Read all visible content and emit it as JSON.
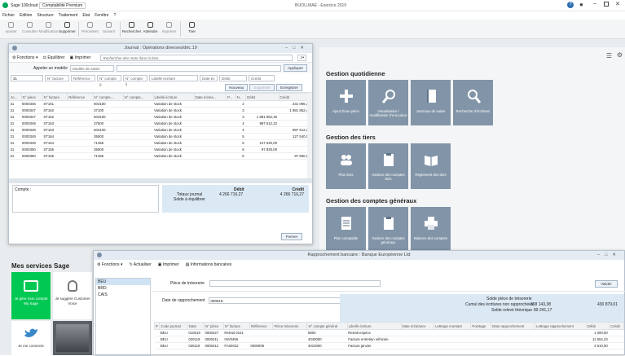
{
  "app": {
    "product": "Sage 100cloud",
    "module": "Comptabilité Premium",
    "title": "BIJOU.MAE - Exercice 2019"
  },
  "menu": [
    "Fichier",
    "Edition",
    "Structure",
    "Traitement",
    "Etat",
    "Fenêtre",
    "?"
  ],
  "toolbar": [
    {
      "label": "Ajouter",
      "on": false
    },
    {
      "label": "Consulter",
      "on": false
    },
    {
      "label": "Modification",
      "on": false
    },
    {
      "label": "Supprimer",
      "on": true
    },
    {
      "label": "Précédent",
      "on": false
    },
    {
      "label": "Suivant",
      "on": false
    },
    {
      "label": "Rechercher",
      "on": true
    },
    {
      "label": "Atteindre",
      "on": true
    },
    {
      "label": "Imprimer",
      "on": false
    },
    {
      "label": "Trier",
      "on": true
    }
  ],
  "journal": {
    "title": "Journal : Opérations diverses/déc.19",
    "functions": "Fonctions",
    "balance": "Équilibrer",
    "print": "Imprimer",
    "search_placeholder": "Rechercher des mots dans la liste...",
    "model_label": "Appeler un modèle",
    "model_value": "Modèle de saisie",
    "apply": "Appliquer",
    "entry_day": "31",
    "entry_fields": [
      "N° facture",
      "Référence",
      "N° compte g",
      "N° compte ti",
      "Libellé écriture",
      "Date éc",
      "Débit",
      "Crédit"
    ],
    "new": "Nouveau",
    "delete": "Supprimer",
    "save": "Enregistrer",
    "columns": [
      "Jo...",
      "N° pièce",
      "N° facture",
      "Référence",
      "N° compte...",
      "N° compte...",
      "Libellé écriture",
      "Date échéa...",
      "P...",
      "N...",
      "Débit",
      "Crédit"
    ],
    "rows": [
      [
        "31",
        "0000346",
        "ST161",
        "",
        "603100",
        "",
        "Variation de stock",
        "",
        "",
        "2",
        "",
        "231 096,32"
      ],
      [
        "31",
        "0000347",
        "ST162",
        "",
        "37100",
        "",
        "Variation de stock",
        "",
        "",
        "3",
        "",
        "1 881 852,46"
      ],
      [
        "31",
        "0000347",
        "ST162",
        "",
        "603100",
        "",
        "Variation de stock",
        "",
        "",
        "3",
        "1 881 852,46",
        ""
      ],
      [
        "31",
        "0000348",
        "ST163",
        "",
        "37500",
        "",
        "Variation de stock",
        "",
        "",
        "4",
        "987 512,22",
        ""
      ],
      [
        "31",
        "0000348",
        "ST163",
        "",
        "603100",
        "",
        "Variation de stock",
        "",
        "",
        "4",
        "",
        "987 512,22"
      ],
      [
        "31",
        "0000349",
        "ST164",
        "",
        "35500",
        "",
        "Variation de stock",
        "",
        "",
        "5",
        "",
        "127 540,00"
      ],
      [
        "31",
        "0000349",
        "ST164",
        "",
        "71355",
        "",
        "Variation de stock",
        "",
        "",
        "5",
        "127 540,00",
        ""
      ],
      [
        "31",
        "0000350",
        "ST165",
        "",
        "35500",
        "",
        "Variation de stock",
        "",
        "",
        "6",
        "97 830,00",
        ""
      ],
      [
        "31",
        "0000350",
        "ST165",
        "",
        "71355",
        "",
        "Variation de stock",
        "",
        "",
        "6",
        "",
        "97 830,00"
      ]
    ],
    "compte_label": "Compte :",
    "debit_h": "Débit",
    "credit_h": "Crédit",
    "total_label": "Totaux journal",
    "total_debit": "4 266 716,27",
    "total_credit": "4 266 716,27",
    "solde_label": "Solde à équilibrer",
    "close": "Fermer"
  },
  "services": {
    "title": "Mes services Sage",
    "tiles": [
      {
        "label": "Je gère mon compte My Sage",
        "icon": "id-card-icon"
      },
      {
        "label": "Je suggère Customer Voice",
        "icon": "lightbulb-icon"
      },
      {
        "label": "",
        "icon": "people-icon"
      },
      {
        "label": "Je me connecte",
        "icon": "twitter-icon"
      }
    ]
  },
  "groups": [
    {
      "title": "Gestion quotidienne",
      "tiles": [
        {
          "label": "Ajout d'une pièce",
          "icon": "plus-icon"
        },
        {
          "label": "Visualisation / modification d'une pièce",
          "icon": "magnifier-icon"
        },
        {
          "label": "Journaux de saisie",
          "icon": "book-icon"
        },
        {
          "label": "Recherche d'écritures",
          "icon": "search-doc-icon"
        }
      ]
    },
    {
      "title": "Gestion des tiers",
      "tiles": [
        {
          "label": "Plan tiers",
          "icon": "people-icon"
        },
        {
          "label": "Gestion des comptes tiers",
          "icon": "clipboard-icon"
        },
        {
          "label": "Réglement des tiers",
          "icon": "open-book-icon"
        }
      ]
    },
    {
      "title": "Gestion des comptes généraux",
      "tiles": [
        {
          "label": "Plan comptable",
          "icon": "list-doc-icon"
        },
        {
          "label": "Gestion des comptes généraux",
          "icon": "clipboard-icon"
        },
        {
          "label": "Balance des comptes",
          "icon": "printer-icon"
        }
      ]
    }
  ],
  "rappro": {
    "title": "Rapprochement bancaire : Banque Européenne Ltd",
    "functions": "Fonctions",
    "refresh": "Actualiser",
    "print": "Imprimer",
    "bank_info": "Informations bancaires",
    "journals": [
      "BEU",
      "BRD",
      "CAIS"
    ],
    "piece_label": "Pièce de trésorerie",
    "validate": "Valider",
    "date_label": "Date de rapprochement",
    "date_value": "080819",
    "solde_piece": "Solde pièce de trésorerie",
    "cumul_label": "Cumul des écritures non rapprochées",
    "cumul_val1": "368 143,38",
    "cumul_val2": "430 879,01",
    "solde_releve": "Solde relevé théorique",
    "releve_val": "89 241,17",
    "columns": [
      "P",
      "Code journal",
      "Date",
      "N° pièce",
      "N° facture",
      "Référence",
      "Pièce trésorerie",
      "N° compte général",
      "Libellé écriture",
      "Date échéance",
      "Lettrage montant",
      "Pointage",
      "Date rapprochement",
      "Lettrage rapprochement",
      "Débit",
      "Crédit"
    ],
    "rows": [
      [
        "",
        "BEU",
        "010519",
        "0000427",
        "Retrait 0101",
        "",
        "",
        "5800",
        "Retrait espèce",
        "",
        "",
        "",
        "",
        "",
        "1 000,00",
        ""
      ],
      [
        "",
        "BEU",
        "020119",
        "0000411",
        "INV0456",
        "",
        "",
        "4040000",
        "Facture entretien véhicule",
        "",
        "",
        "",
        "",
        "",
        "11 554,23",
        ""
      ],
      [
        "",
        "BEU",
        "030119",
        "0000412",
        "FA00022",
        "0000005",
        "",
        "4010000",
        "Facture janvier",
        "",
        "",
        "",
        "",
        "",
        "4 610,00",
        ""
      ]
    ]
  }
}
